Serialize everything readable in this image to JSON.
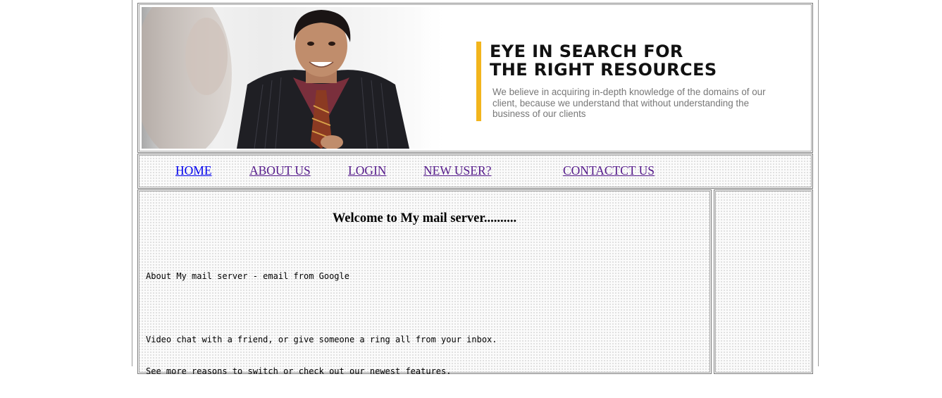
{
  "banner": {
    "headline_line1": "EYE IN SEARCH FOR",
    "headline_line2": "THE RIGHT RESOURCES",
    "subtext": "We believe in acquiring in-depth knowledge of the domains of our client, because we understand that without understanding the business of our clients",
    "accent_color": "#f2b51d"
  },
  "nav": {
    "items": [
      {
        "label": "HOME"
      },
      {
        "label": "ABOUT US"
      },
      {
        "label": "LOGIN"
      },
      {
        "label": "NEW USER?"
      },
      {
        "label": "CONTACTCT US"
      }
    ],
    "link_color": "#0000ee",
    "visited_color": "#551a8b"
  },
  "main": {
    "welcome": "Welcome to My mail server..........",
    "line1": "About My mail server - email from Google",
    "line2": "Video chat with a friend, or give someone a ring all from your inbox.",
    "line3": "See more reasons to switch or check out our newest features."
  }
}
